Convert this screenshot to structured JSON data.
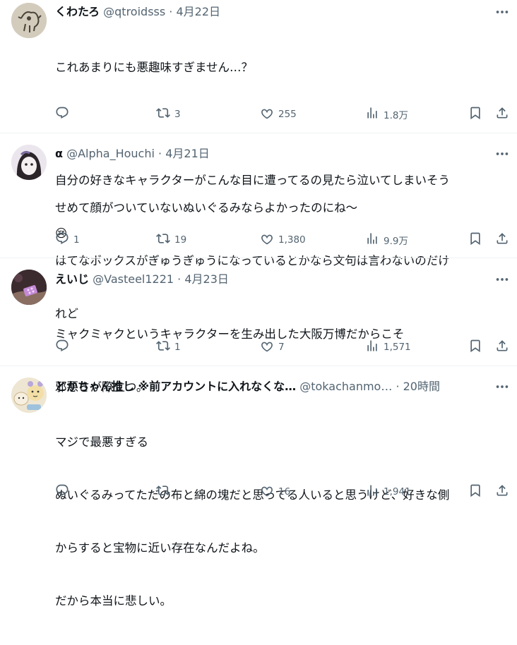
{
  "tweets": [
    {
      "name": "くわたろ",
      "handle": "@qtroidsss",
      "sep": "·",
      "time": "4月22日",
      "lines": [
        "これあまりにも悪趣味すぎません…？",
        "",
        "自分の好きなキャラクターがこんな目に遭ってるの見たら泣いてしまいそう",
        "😢"
      ],
      "replies": "",
      "retweets": "3",
      "likes": "255",
      "views": "1.8万"
    },
    {
      "name": "α",
      "handle": "@Alpha_Houchi",
      "sep": "·",
      "time": "4月21日",
      "lines": [
        "せめて顔がついていないぬいぐるみならよかったのにね～",
        "はてなボックスがぎゅうぎゅうになっているとかなら文句は言わないのだけ",
        "れど"
      ],
      "replies": "1",
      "retweets": "19",
      "likes": "1,380",
      "views": "9.9万"
    },
    {
      "name": "えいじ",
      "handle": "@Vasteel1221",
      "sep": "·",
      "time": "4月23日",
      "lines": [
        "ミャクミャクというキャラクターを生み出した大阪万博だからこそ",
        "邪悪さが際立つ。"
      ],
      "replies": "",
      "retweets": "1",
      "likes": "7",
      "views": "1,571"
    },
    {
      "name": "とかちゃん推し ※前アカウントに入れなくな…",
      "handle": "@tokachanmo…",
      "sep": "·",
      "time": "20時間",
      "lines": [
        "マジで最悪すぎる",
        "ぬいぐるみってただの布と綿の塊だと思ってる人いると思うけど、好きな側",
        "からすると宝物に近い存在なんだよね。",
        "だから本当に悲しい。"
      ],
      "replies": "",
      "retweets": "",
      "likes": "16",
      "views": "1,941"
    }
  ],
  "icons": {
    "more": "more-icon",
    "reply": "reply-icon",
    "retweet": "retweet-icon",
    "like": "like-icon",
    "views": "views-icon",
    "bookmark": "bookmark-icon",
    "share": "share-icon"
  },
  "colors": {
    "text": "#0f1419",
    "secondary": "#536471",
    "divider": "#eff3f4"
  }
}
